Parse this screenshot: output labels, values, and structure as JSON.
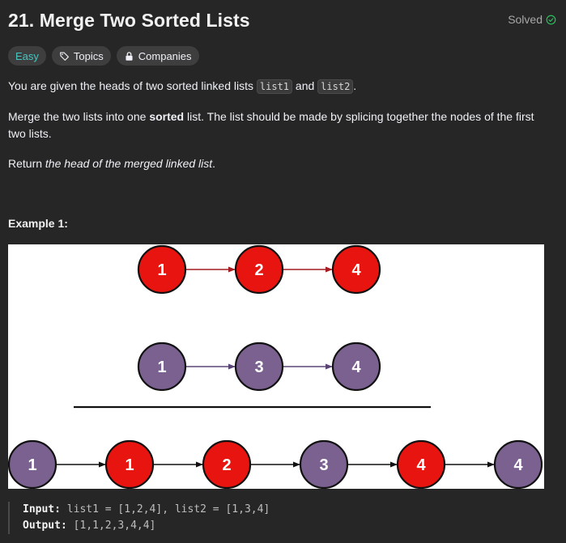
{
  "header": {
    "title": "21. Merge Two Sorted Lists",
    "status": "Solved"
  },
  "tags": {
    "difficulty": "Easy",
    "topics": "Topics",
    "companies": "Companies"
  },
  "description": {
    "p1_before": "You are given the heads of two sorted linked lists ",
    "p1_code1": "list1",
    "p1_mid": " and ",
    "p1_code2": "list2",
    "p1_after": ".",
    "p2_before": "Merge the two lists into one ",
    "p2_bold": "sorted",
    "p2_after": " list. The list should be made by splicing together the nodes of the first two lists.",
    "p3_before": "Return ",
    "p3_italic": "the head of the merged linked list",
    "p3_after": "."
  },
  "example": {
    "title": "Example 1:",
    "input_label": "Input:",
    "input_value": "list1 = [1,2,4], list2 = [1,3,4]",
    "output_label": "Output:",
    "output_value": "[1,1,2,3,4,4]"
  },
  "diagram_data": {
    "list1": [
      "1",
      "2",
      "4"
    ],
    "list2": [
      "1",
      "3",
      "4"
    ],
    "merged": [
      {
        "value": "1",
        "from": "list2"
      },
      {
        "value": "1",
        "from": "list1"
      },
      {
        "value": "2",
        "from": "list1"
      },
      {
        "value": "3",
        "from": "list2"
      },
      {
        "value": "4",
        "from": "list1"
      },
      {
        "value": "4",
        "from": "list2"
      }
    ],
    "colors": {
      "list1": "#e8140f",
      "list2": "#7a6190",
      "list1_arrow": "#a31d22",
      "list2_arrow": "#5a4676",
      "merged_arrow": "#111111"
    }
  },
  "colors": {
    "background": "#262626",
    "easy": "#46c6c2",
    "solved_check": "#2cbb5d"
  }
}
